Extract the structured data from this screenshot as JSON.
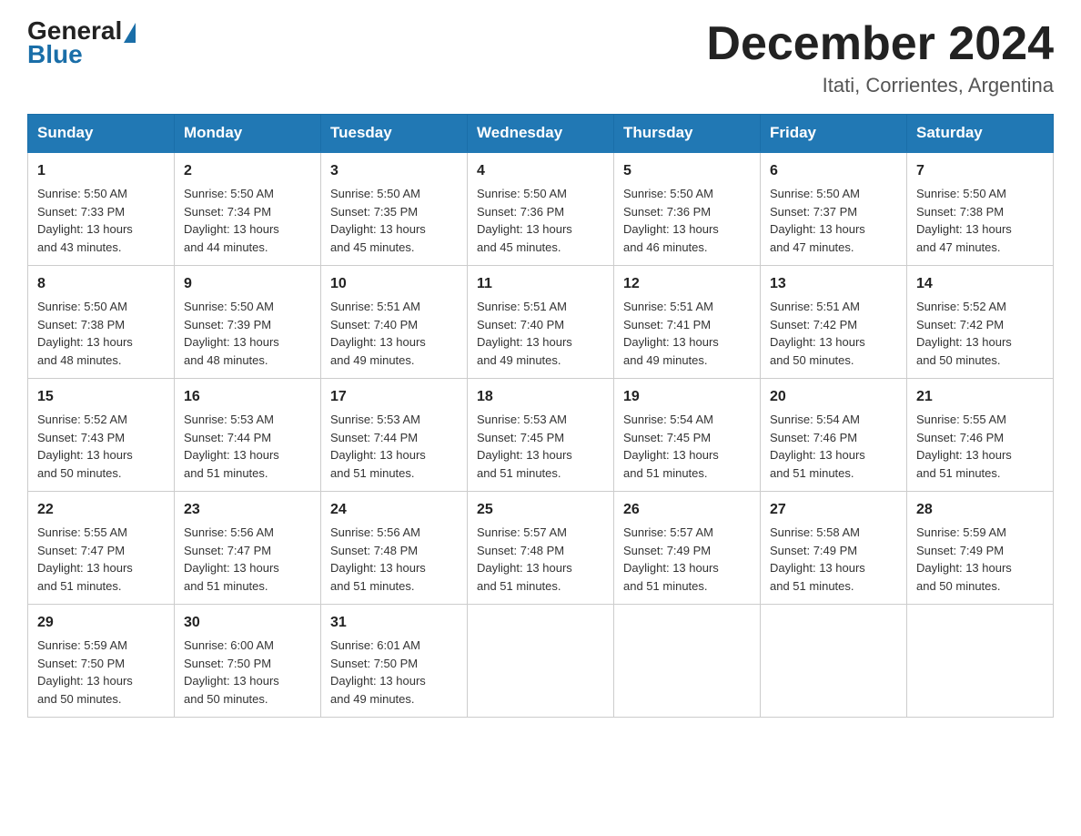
{
  "header": {
    "logo_general": "General",
    "logo_blue": "Blue",
    "month_title": "December 2024",
    "location": "Itati, Corrientes, Argentina"
  },
  "days_of_week": [
    "Sunday",
    "Monday",
    "Tuesday",
    "Wednesday",
    "Thursday",
    "Friday",
    "Saturday"
  ],
  "weeks": [
    [
      {
        "day": "1",
        "sunrise": "5:50 AM",
        "sunset": "7:33 PM",
        "daylight": "13 hours and 43 minutes."
      },
      {
        "day": "2",
        "sunrise": "5:50 AM",
        "sunset": "7:34 PM",
        "daylight": "13 hours and 44 minutes."
      },
      {
        "day": "3",
        "sunrise": "5:50 AM",
        "sunset": "7:35 PM",
        "daylight": "13 hours and 45 minutes."
      },
      {
        "day": "4",
        "sunrise": "5:50 AM",
        "sunset": "7:36 PM",
        "daylight": "13 hours and 45 minutes."
      },
      {
        "day": "5",
        "sunrise": "5:50 AM",
        "sunset": "7:36 PM",
        "daylight": "13 hours and 46 minutes."
      },
      {
        "day": "6",
        "sunrise": "5:50 AM",
        "sunset": "7:37 PM",
        "daylight": "13 hours and 47 minutes."
      },
      {
        "day": "7",
        "sunrise": "5:50 AM",
        "sunset": "7:38 PM",
        "daylight": "13 hours and 47 minutes."
      }
    ],
    [
      {
        "day": "8",
        "sunrise": "5:50 AM",
        "sunset": "7:38 PM",
        "daylight": "13 hours and 48 minutes."
      },
      {
        "day": "9",
        "sunrise": "5:50 AM",
        "sunset": "7:39 PM",
        "daylight": "13 hours and 48 minutes."
      },
      {
        "day": "10",
        "sunrise": "5:51 AM",
        "sunset": "7:40 PM",
        "daylight": "13 hours and 49 minutes."
      },
      {
        "day": "11",
        "sunrise": "5:51 AM",
        "sunset": "7:40 PM",
        "daylight": "13 hours and 49 minutes."
      },
      {
        "day": "12",
        "sunrise": "5:51 AM",
        "sunset": "7:41 PM",
        "daylight": "13 hours and 49 minutes."
      },
      {
        "day": "13",
        "sunrise": "5:51 AM",
        "sunset": "7:42 PM",
        "daylight": "13 hours and 50 minutes."
      },
      {
        "day": "14",
        "sunrise": "5:52 AM",
        "sunset": "7:42 PM",
        "daylight": "13 hours and 50 minutes."
      }
    ],
    [
      {
        "day": "15",
        "sunrise": "5:52 AM",
        "sunset": "7:43 PM",
        "daylight": "13 hours and 50 minutes."
      },
      {
        "day": "16",
        "sunrise": "5:53 AM",
        "sunset": "7:44 PM",
        "daylight": "13 hours and 51 minutes."
      },
      {
        "day": "17",
        "sunrise": "5:53 AM",
        "sunset": "7:44 PM",
        "daylight": "13 hours and 51 minutes."
      },
      {
        "day": "18",
        "sunrise": "5:53 AM",
        "sunset": "7:45 PM",
        "daylight": "13 hours and 51 minutes."
      },
      {
        "day": "19",
        "sunrise": "5:54 AM",
        "sunset": "7:45 PM",
        "daylight": "13 hours and 51 minutes."
      },
      {
        "day": "20",
        "sunrise": "5:54 AM",
        "sunset": "7:46 PM",
        "daylight": "13 hours and 51 minutes."
      },
      {
        "day": "21",
        "sunrise": "5:55 AM",
        "sunset": "7:46 PM",
        "daylight": "13 hours and 51 minutes."
      }
    ],
    [
      {
        "day": "22",
        "sunrise": "5:55 AM",
        "sunset": "7:47 PM",
        "daylight": "13 hours and 51 minutes."
      },
      {
        "day": "23",
        "sunrise": "5:56 AM",
        "sunset": "7:47 PM",
        "daylight": "13 hours and 51 minutes."
      },
      {
        "day": "24",
        "sunrise": "5:56 AM",
        "sunset": "7:48 PM",
        "daylight": "13 hours and 51 minutes."
      },
      {
        "day": "25",
        "sunrise": "5:57 AM",
        "sunset": "7:48 PM",
        "daylight": "13 hours and 51 minutes."
      },
      {
        "day": "26",
        "sunrise": "5:57 AM",
        "sunset": "7:49 PM",
        "daylight": "13 hours and 51 minutes."
      },
      {
        "day": "27",
        "sunrise": "5:58 AM",
        "sunset": "7:49 PM",
        "daylight": "13 hours and 51 minutes."
      },
      {
        "day": "28",
        "sunrise": "5:59 AM",
        "sunset": "7:49 PM",
        "daylight": "13 hours and 50 minutes."
      }
    ],
    [
      {
        "day": "29",
        "sunrise": "5:59 AM",
        "sunset": "7:50 PM",
        "daylight": "13 hours and 50 minutes."
      },
      {
        "day": "30",
        "sunrise": "6:00 AM",
        "sunset": "7:50 PM",
        "daylight": "13 hours and 50 minutes."
      },
      {
        "day": "31",
        "sunrise": "6:01 AM",
        "sunset": "7:50 PM",
        "daylight": "13 hours and 49 minutes."
      },
      null,
      null,
      null,
      null
    ]
  ],
  "labels": {
    "sunrise": "Sunrise:",
    "sunset": "Sunset:",
    "daylight": "Daylight:"
  }
}
